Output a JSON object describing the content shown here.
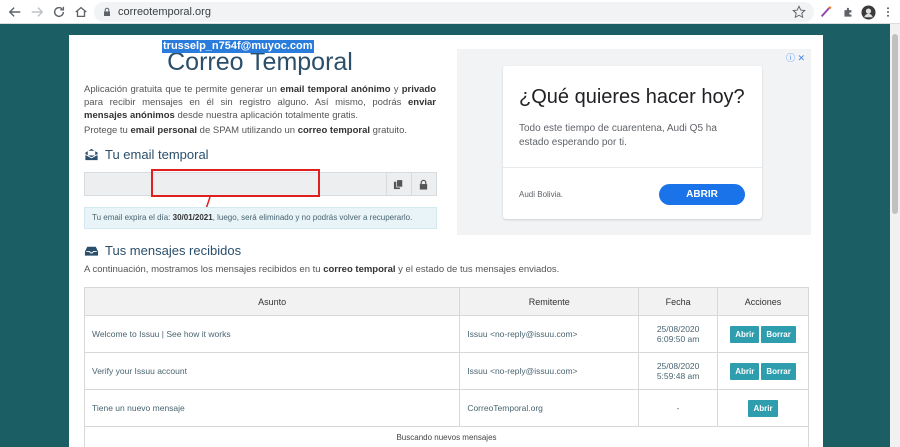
{
  "browser": {
    "url": "correotemporal.org",
    "icons": [
      "back-icon",
      "forward-icon",
      "reload-icon",
      "lock-icon",
      "star-icon",
      "extension-icon",
      "puzzle-icon",
      "profile-icon",
      "menu-icon"
    ]
  },
  "header": {
    "title": "Correo Temporal",
    "intro_1": "Aplicación gratuita que te permite generar un ",
    "intro_b1": "email temporal anónimo",
    "intro_2": " y ",
    "intro_b2": "privado",
    "intro_3": " para recibir mensajes en él sin registro alguno. Así mismo, podrás ",
    "intro_b3": "enviar mensajes anónimos",
    "intro_4": " desde nuestra aplicación totalmente gratis.",
    "protect_1": "Protege tu ",
    "protect_b1": "email personal",
    "protect_2": " de SPAM utilizando un ",
    "protect_b2": "correo temporal",
    "protect_3": " gratuito."
  },
  "email_section": {
    "heading": "Tu email temporal",
    "email": "trusselp_n754f@muyoc.com",
    "expire_1": "Tu email expira el día: ",
    "expire_date": "30/01/2021",
    "expire_2": ", luego, será eliminado y no podrás volver a recuperarlo."
  },
  "ad": {
    "info": "ⓘ ✕",
    "headline": "¿Qué quieres hacer hoy?",
    "body": "Todo este tiempo de cuarentena, Audi Q5 ha estado esperando por ti.",
    "brand": "Audi Bolivia.",
    "cta": "ABRIR"
  },
  "messages": {
    "heading": "Tus mensajes recibidos",
    "desc_1": "A continuación, mostramos los mensajes recibidos en tu ",
    "desc_b1": "correo temporal",
    "desc_2": " y el estado de tus mensajes enviados.",
    "columns": [
      "Asunto",
      "Remitente",
      "Fecha",
      "Acciones"
    ],
    "rows": [
      {
        "subject": "Welcome to Issuu | See how it works",
        "sender": "Issuu <no-reply@issuu.com>",
        "date": "25/08/2020",
        "time": "6:09:50 am",
        "open": "Abrir",
        "delete": "Borrar"
      },
      {
        "subject": "Verify your Issuu account",
        "sender": "Issuu <no-reply@issuu.com>",
        "date": "25/08/2020",
        "time": "5:59:48 am",
        "open": "Abrir",
        "delete": "Borrar"
      },
      {
        "subject": "Tiene un nuevo mensaje",
        "sender": "CorreoTemporal.org",
        "date": "-",
        "time": "",
        "open": "Abrir"
      }
    ],
    "loading": "Buscando nuevos mensajes"
  }
}
